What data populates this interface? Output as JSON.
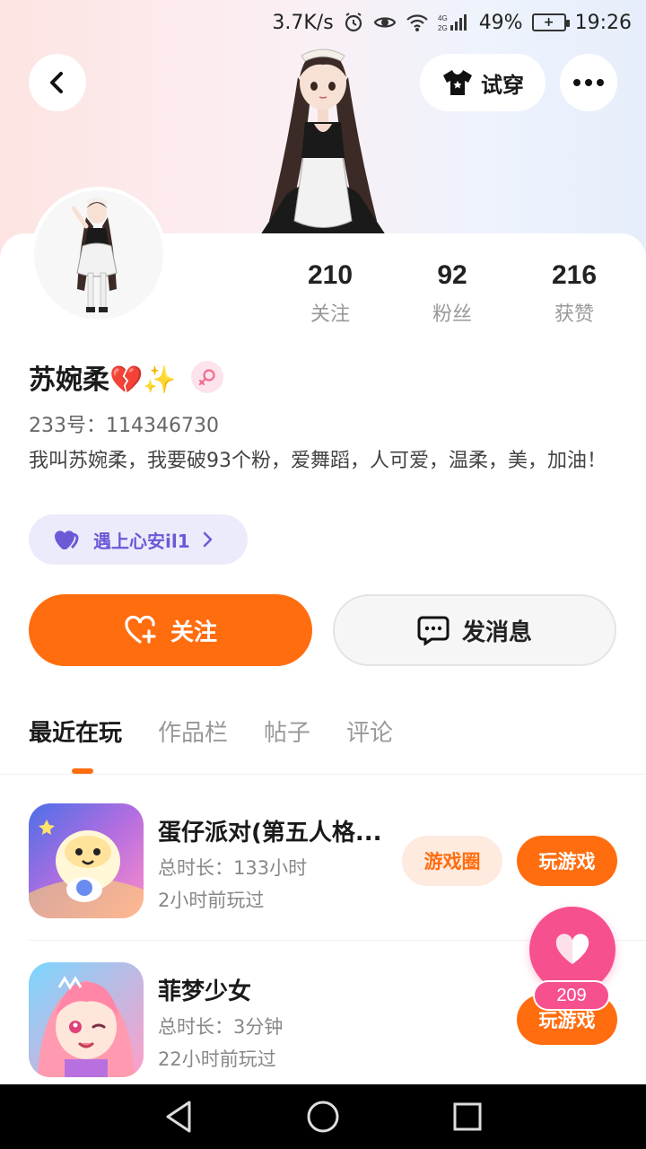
{
  "status_bar": {
    "speed": "3.7K/s",
    "network": "4G 2G",
    "battery": "49%",
    "time": "19:26"
  },
  "header": {
    "try_on_label": "试穿"
  },
  "profile": {
    "stats": [
      {
        "value": "210",
        "label": "关注"
      },
      {
        "value": "92",
        "label": "粉丝"
      },
      {
        "value": "216",
        "label": "获赞"
      }
    ],
    "name": "苏婉柔💔✨",
    "uid": "233号：114346730",
    "bio": "我叫苏婉柔，我要破93个粉，爱舞蹈，人可爱，温柔，美，加油！",
    "couple_label": "遇上心安il1"
  },
  "actions": {
    "follow_label": "关注",
    "message_label": "发消息"
  },
  "tabs": [
    {
      "label": "最近在玩",
      "active": true
    },
    {
      "label": "作品栏",
      "active": false
    },
    {
      "label": "帖子",
      "active": false
    },
    {
      "label": "评论",
      "active": false
    }
  ],
  "games": [
    {
      "title": "蛋仔派对(第五人格...",
      "duration": "总时长：133小时",
      "last_played": "2小时前玩过",
      "circle_label": "游戏圈",
      "play_label": "玩游戏"
    },
    {
      "title": "菲梦少女",
      "duration": "总时长：3分钟",
      "last_played": "22小时前玩过",
      "play_label": "玩游戏"
    }
  ],
  "like_fab": {
    "count": "209"
  },
  "colors": {
    "accent": "#ff6d0f",
    "pink": "#f7508f",
    "purple": "#6a5ad6"
  }
}
